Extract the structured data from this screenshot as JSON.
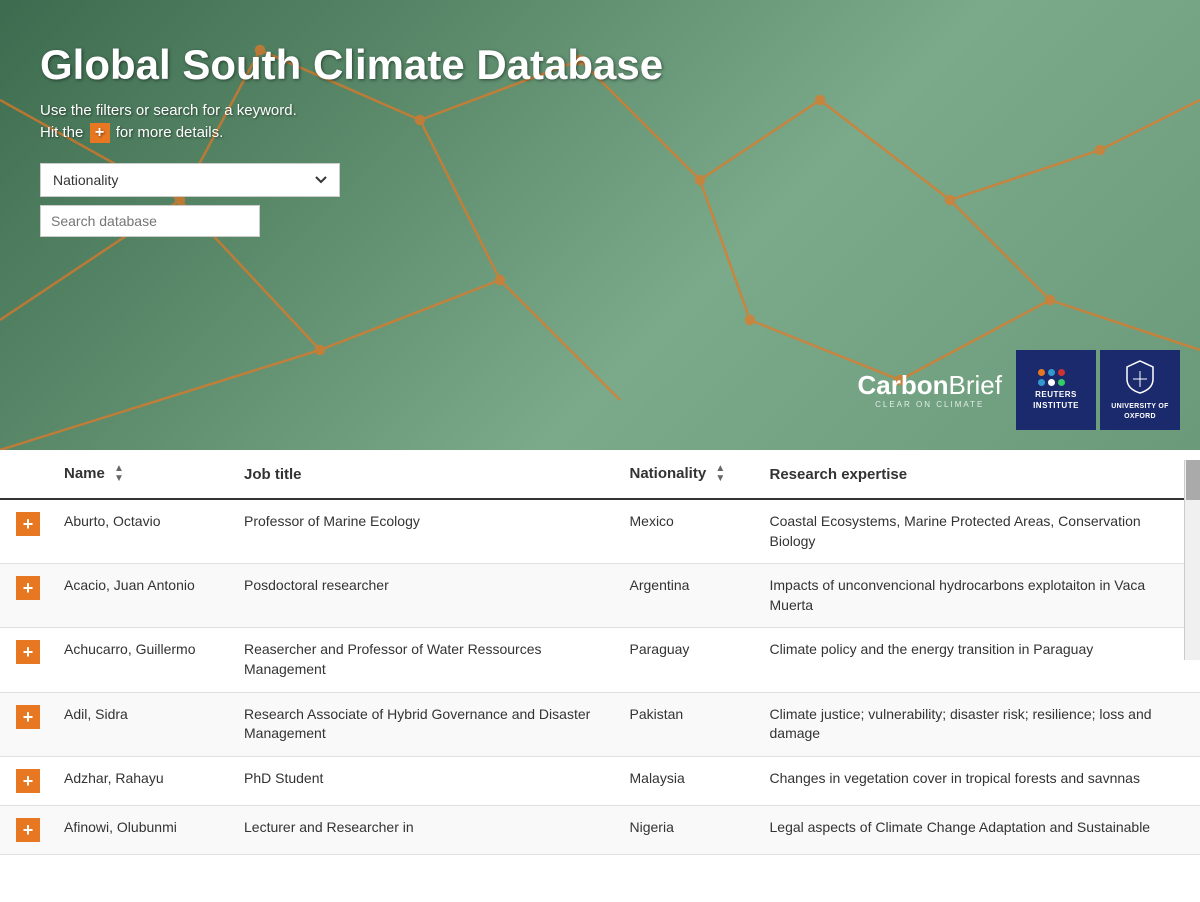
{
  "hero": {
    "title": "Global South Climate Database",
    "subtitle1": "Use the filters or search for a keyword.",
    "subtitle2": "Hit the",
    "subtitle2_end": "for more details.",
    "plus_icon": "+",
    "nationality_label": "Nationality",
    "nationality_default": "Nationality",
    "search_placeholder": "Search database",
    "carbonbrief": {
      "name": "CarbonBrief",
      "tagline": "CLEAR ON CLIMATE"
    },
    "logos": {
      "reuters": "REUTERS INSTITUTE",
      "oxford": "UNIVERSITY OF OXFORD"
    }
  },
  "table": {
    "columns": [
      {
        "label": "",
        "key": "expand"
      },
      {
        "label": "Name",
        "key": "name",
        "sortable": true
      },
      {
        "label": "Job title",
        "key": "job_title",
        "sortable": false
      },
      {
        "label": "Nationality",
        "key": "nationality",
        "sortable": true
      },
      {
        "label": "Research expertise",
        "key": "research_expertise",
        "sortable": false
      }
    ],
    "rows": [
      {
        "first_name": "Octavio",
        "last_name": "Aburto",
        "job_title": "Professor of Marine Ecology",
        "nationality": "Mexico",
        "research_expertise": "Coastal Ecosystems, Marine Protected Areas, Conservation Biology"
      },
      {
        "first_name": "Juan Antonio",
        "last_name": "Acacio",
        "job_title": "Posdoctoral researcher",
        "nationality": "Argentina",
        "research_expertise": "Impacts of unconvencional hydrocarbons explotaiton in Vaca Muerta"
      },
      {
        "first_name": "Guillermo",
        "last_name": "Achucarro",
        "job_title": "Reasercher and Professor of Water Ressources Management",
        "nationality": "Paraguay",
        "research_expertise": "Climate policy and the energy transition in Paraguay"
      },
      {
        "first_name": "Sidra",
        "last_name": "Adil",
        "job_title": "Research Associate of Hybrid Governance and Disaster Management",
        "nationality": "Pakistan",
        "research_expertise": "Climate justice; vulnerability; disaster risk; resilience; loss and damage"
      },
      {
        "first_name": "Rahayu",
        "last_name": "Adzhar",
        "job_title": "PhD Student",
        "nationality": "Malaysia",
        "research_expertise": "Changes in vegetation cover in tropical forests and savnnas"
      },
      {
        "first_name": "Olubunmi",
        "last_name": "Afinowi",
        "job_title": "Lecturer and Researcher in",
        "nationality": "Nigeria",
        "research_expertise": "Legal aspects of Climate Change Adaptation and Sustainable"
      }
    ]
  }
}
